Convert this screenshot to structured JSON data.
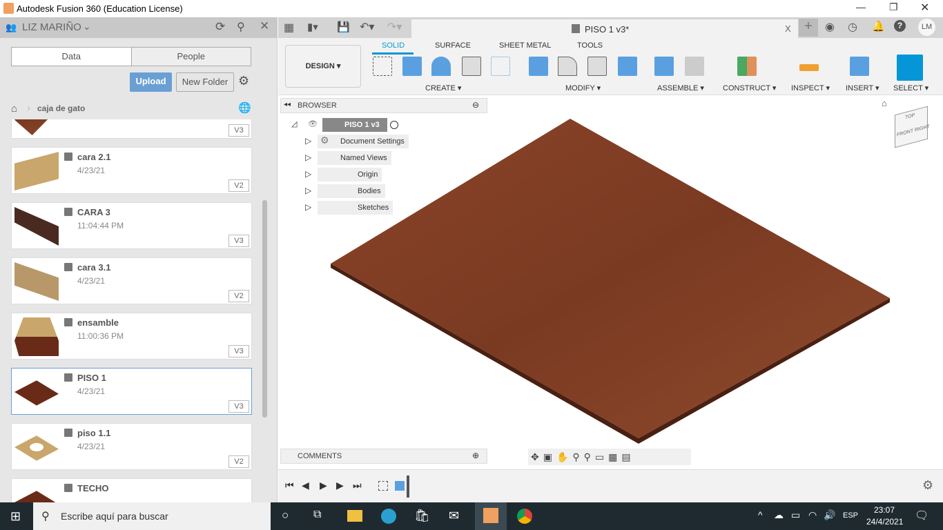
{
  "window": {
    "title": "Autodesk Fusion 360 (Education License)"
  },
  "data_panel": {
    "user": "LIZ MARIÑO",
    "tabs": [
      "Data",
      "People"
    ],
    "upload": "Upload",
    "new_folder": "New Folder",
    "breadcrumb": "caja de gato",
    "items": [
      {
        "name": "",
        "date": "",
        "version": "V3"
      },
      {
        "name": "cara 2.1",
        "date": "4/23/21",
        "version": "V2"
      },
      {
        "name": "CARA 3",
        "date": "11:04:44 PM",
        "version": "V3"
      },
      {
        "name": "cara 3.1",
        "date": "4/23/21",
        "version": "V2"
      },
      {
        "name": "ensamble",
        "date": "11:00:36 PM",
        "version": "V3"
      },
      {
        "name": "PISO 1",
        "date": "4/23/21",
        "version": "V3",
        "selected": true
      },
      {
        "name": "piso 1.1",
        "date": "4/23/21",
        "version": "V2"
      },
      {
        "name": "TECHO",
        "date": "",
        "version": ""
      }
    ]
  },
  "document_tab": {
    "title": "PISO 1 v3*",
    "close": "X"
  },
  "user_initials": "LM",
  "ribbon": {
    "workspace": "DESIGN ▾",
    "tabs": [
      "SOLID",
      "SURFACE",
      "SHEET METAL",
      "TOOLS"
    ],
    "active_tab": "SOLID",
    "groups": [
      "CREATE ▾",
      "MODIFY ▾",
      "ASSEMBLE ▾",
      "CONSTRUCT ▾",
      "INSPECT ▾",
      "INSERT ▾",
      "SELECT ▾"
    ]
  },
  "browser": {
    "title": "BROWSER",
    "root": "PISO 1 v3",
    "nodes": [
      "Document Settings",
      "Named Views",
      "Origin",
      "Bodies",
      "Sketches"
    ]
  },
  "comments": {
    "title": "COMMENTS"
  },
  "viewcube": {
    "top": "TOP",
    "front": "FRONT",
    "right": "RIGHT"
  },
  "colors": {
    "accent": "#0696d7",
    "wood": "#7a3a22",
    "upload": "#6a9fd4"
  },
  "taskbar": {
    "search_placeholder": "Escribe aquí para buscar",
    "lang": "ESP",
    "time": "23:07",
    "date": "24/4/2021"
  }
}
